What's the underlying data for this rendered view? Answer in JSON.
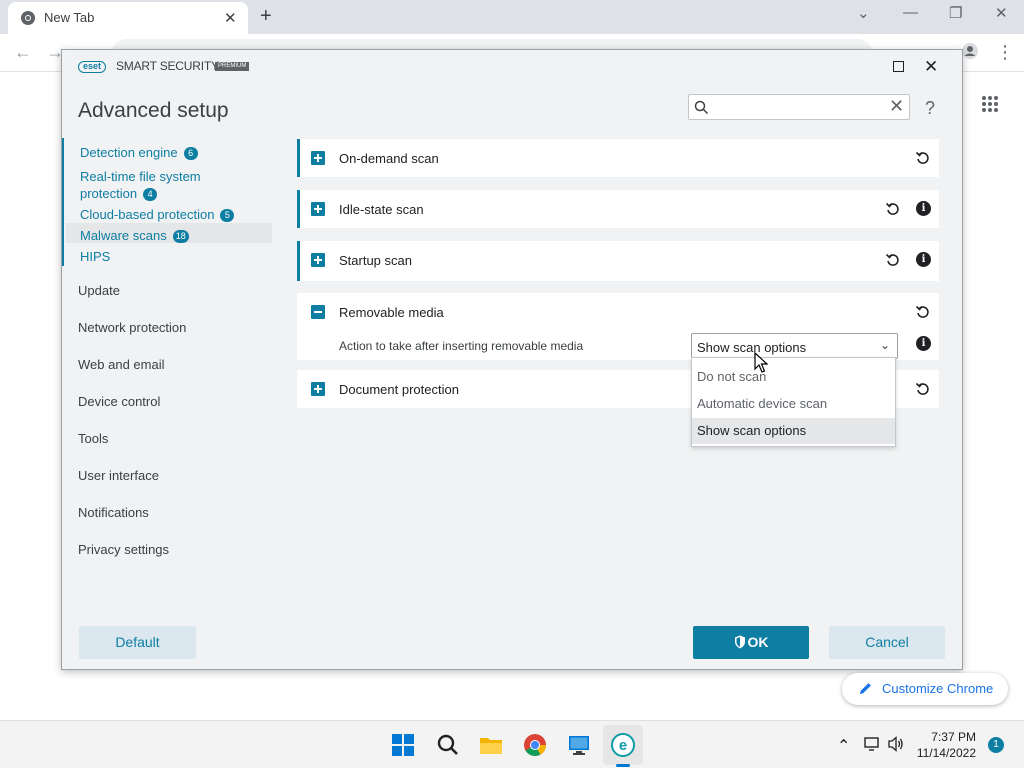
{
  "chrome": {
    "tab_title": "New Tab",
    "customize_label": "Customize Chrome"
  },
  "eset": {
    "logo_text": "eset",
    "product_name": "SMART SECURITY",
    "premium_label": "PREMIUM",
    "page_title": "Advanced setup",
    "search_placeholder": "",
    "help_label": "?"
  },
  "sidebar": {
    "sub_items": [
      {
        "label": "Detection engine",
        "badge": "6"
      },
      {
        "label": "Real-time file system",
        "label2": "protection",
        "badge": "4"
      },
      {
        "label": "Cloud-based protection",
        "badge": "5"
      },
      {
        "label": "Malware scans",
        "badge": "18"
      },
      {
        "label": "HIPS"
      }
    ],
    "main_items": [
      "Update",
      "Network protection",
      "Web and email",
      "Device control",
      "Tools",
      "User interface",
      "Notifications",
      "Privacy settings"
    ]
  },
  "sections": {
    "on_demand": "On-demand scan",
    "idle_state": "Idle-state scan",
    "startup": "Startup scan",
    "removable": "Removable media",
    "document": "Document protection"
  },
  "removable_setting": {
    "label": "Action to take after inserting removable media",
    "value": "Show scan options",
    "options": [
      "Do not scan",
      "Automatic device scan",
      "Show scan options"
    ]
  },
  "buttons": {
    "default": "Default",
    "ok": "OK",
    "cancel": "Cancel"
  },
  "taskbar": {
    "time": "7:37 PM",
    "date": "11/14/2022",
    "notifications": "1"
  },
  "colors": {
    "accent": "#0e7ea3",
    "window_bg": "#f1f2f3"
  }
}
